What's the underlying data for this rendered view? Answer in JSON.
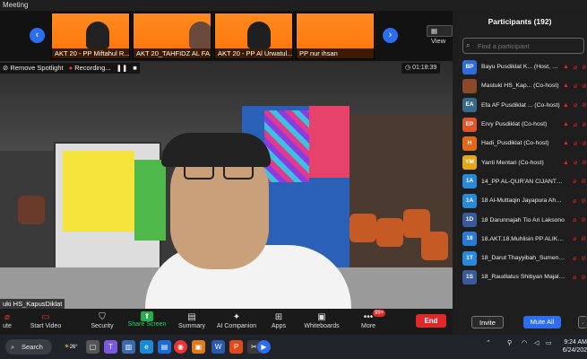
{
  "window": {
    "title": "Meeting"
  },
  "gallery": {
    "prev_icon": "chevron-left-icon",
    "next_icon": "chevron-right-icon",
    "view_label": "View",
    "tiles": [
      {
        "label": "AKT 20 - PP Miftahul R..."
      },
      {
        "label": "AKT 20_TAHFIDZ AL FA..."
      },
      {
        "label": "AKT 20 - PP Al Urwatul..."
      },
      {
        "label": "PP nur ihsan"
      }
    ]
  },
  "video": {
    "spotlight_label": "Remove Spotlight",
    "recording_label": "Recording...",
    "timer": "01:18:39",
    "speaker_name": "uki HS_KapusDiklat"
  },
  "toolbar": {
    "items": [
      {
        "label": "ute"
      },
      {
        "label": "Start Video"
      },
      {
        "label": "Security"
      },
      {
        "label": "Share Screen"
      },
      {
        "label": "Summary"
      },
      {
        "label": "AI Companion"
      },
      {
        "label": "Apps"
      },
      {
        "label": "Whiteboards"
      },
      {
        "label": "More"
      }
    ],
    "more_badge": "99+",
    "end_label": "End"
  },
  "participants": {
    "title": "Participants (192)",
    "search_placeholder": "Find a participant",
    "list": [
      {
        "initials": "BP",
        "color": "#2e6dd8",
        "name": "Bayu Pusdiklat K... (Host, me)"
      },
      {
        "initials": "",
        "color": "#8a4a2a",
        "name": "Mastuki HS_Kap... (Co-host)"
      },
      {
        "initials": "EA",
        "color": "#3a6a8a",
        "name": "Efa AF Pusdiklat ... (Co-host)"
      },
      {
        "initials": "EP",
        "color": "#e0542a",
        "name": "Ervy Pusdiklat (Co-host)"
      },
      {
        "initials": "H",
        "color": "#e06a1a",
        "name": "Hadi_Pusdiklat (Co-host)"
      },
      {
        "initials": "YM",
        "color": "#e0a81a",
        "name": "Yanti Mentari (Co-host)"
      },
      {
        "initials": "1A",
        "color": "#2a8ad8",
        "name": "14_PP AL-QUR'AN CIJANTUNG..."
      },
      {
        "initials": "1A",
        "color": "#2a8ad8",
        "name": "18 Al-Muttaqin Jayapura Ahma..."
      },
      {
        "initials": "1D",
        "color": "#3a5a9a",
        "name": "18 Darunnajah Tio Ari Laksono"
      },
      {
        "initials": "18",
        "color": "#2a7ad8",
        "name": "18.AKT.18.Muhlisin PP ALIKHLA..."
      },
      {
        "initials": "1T",
        "color": "#2a8ad8",
        "name": "18_Darut Thayyibah_Sumenep_..."
      },
      {
        "initials": "1S",
        "color": "#3a5a9a",
        "name": "18_Raudlatus Shibyan Majalen..."
      }
    ],
    "invite_label": "Invite",
    "mute_all_label": "Mute All"
  },
  "taskbar": {
    "search_label": "Search",
    "weather": "26°",
    "time": "9:24 AM",
    "date": "6/24/202"
  },
  "colors": {
    "accent": "#2d6df0",
    "end": "#e02828",
    "share": "#22b14c"
  }
}
